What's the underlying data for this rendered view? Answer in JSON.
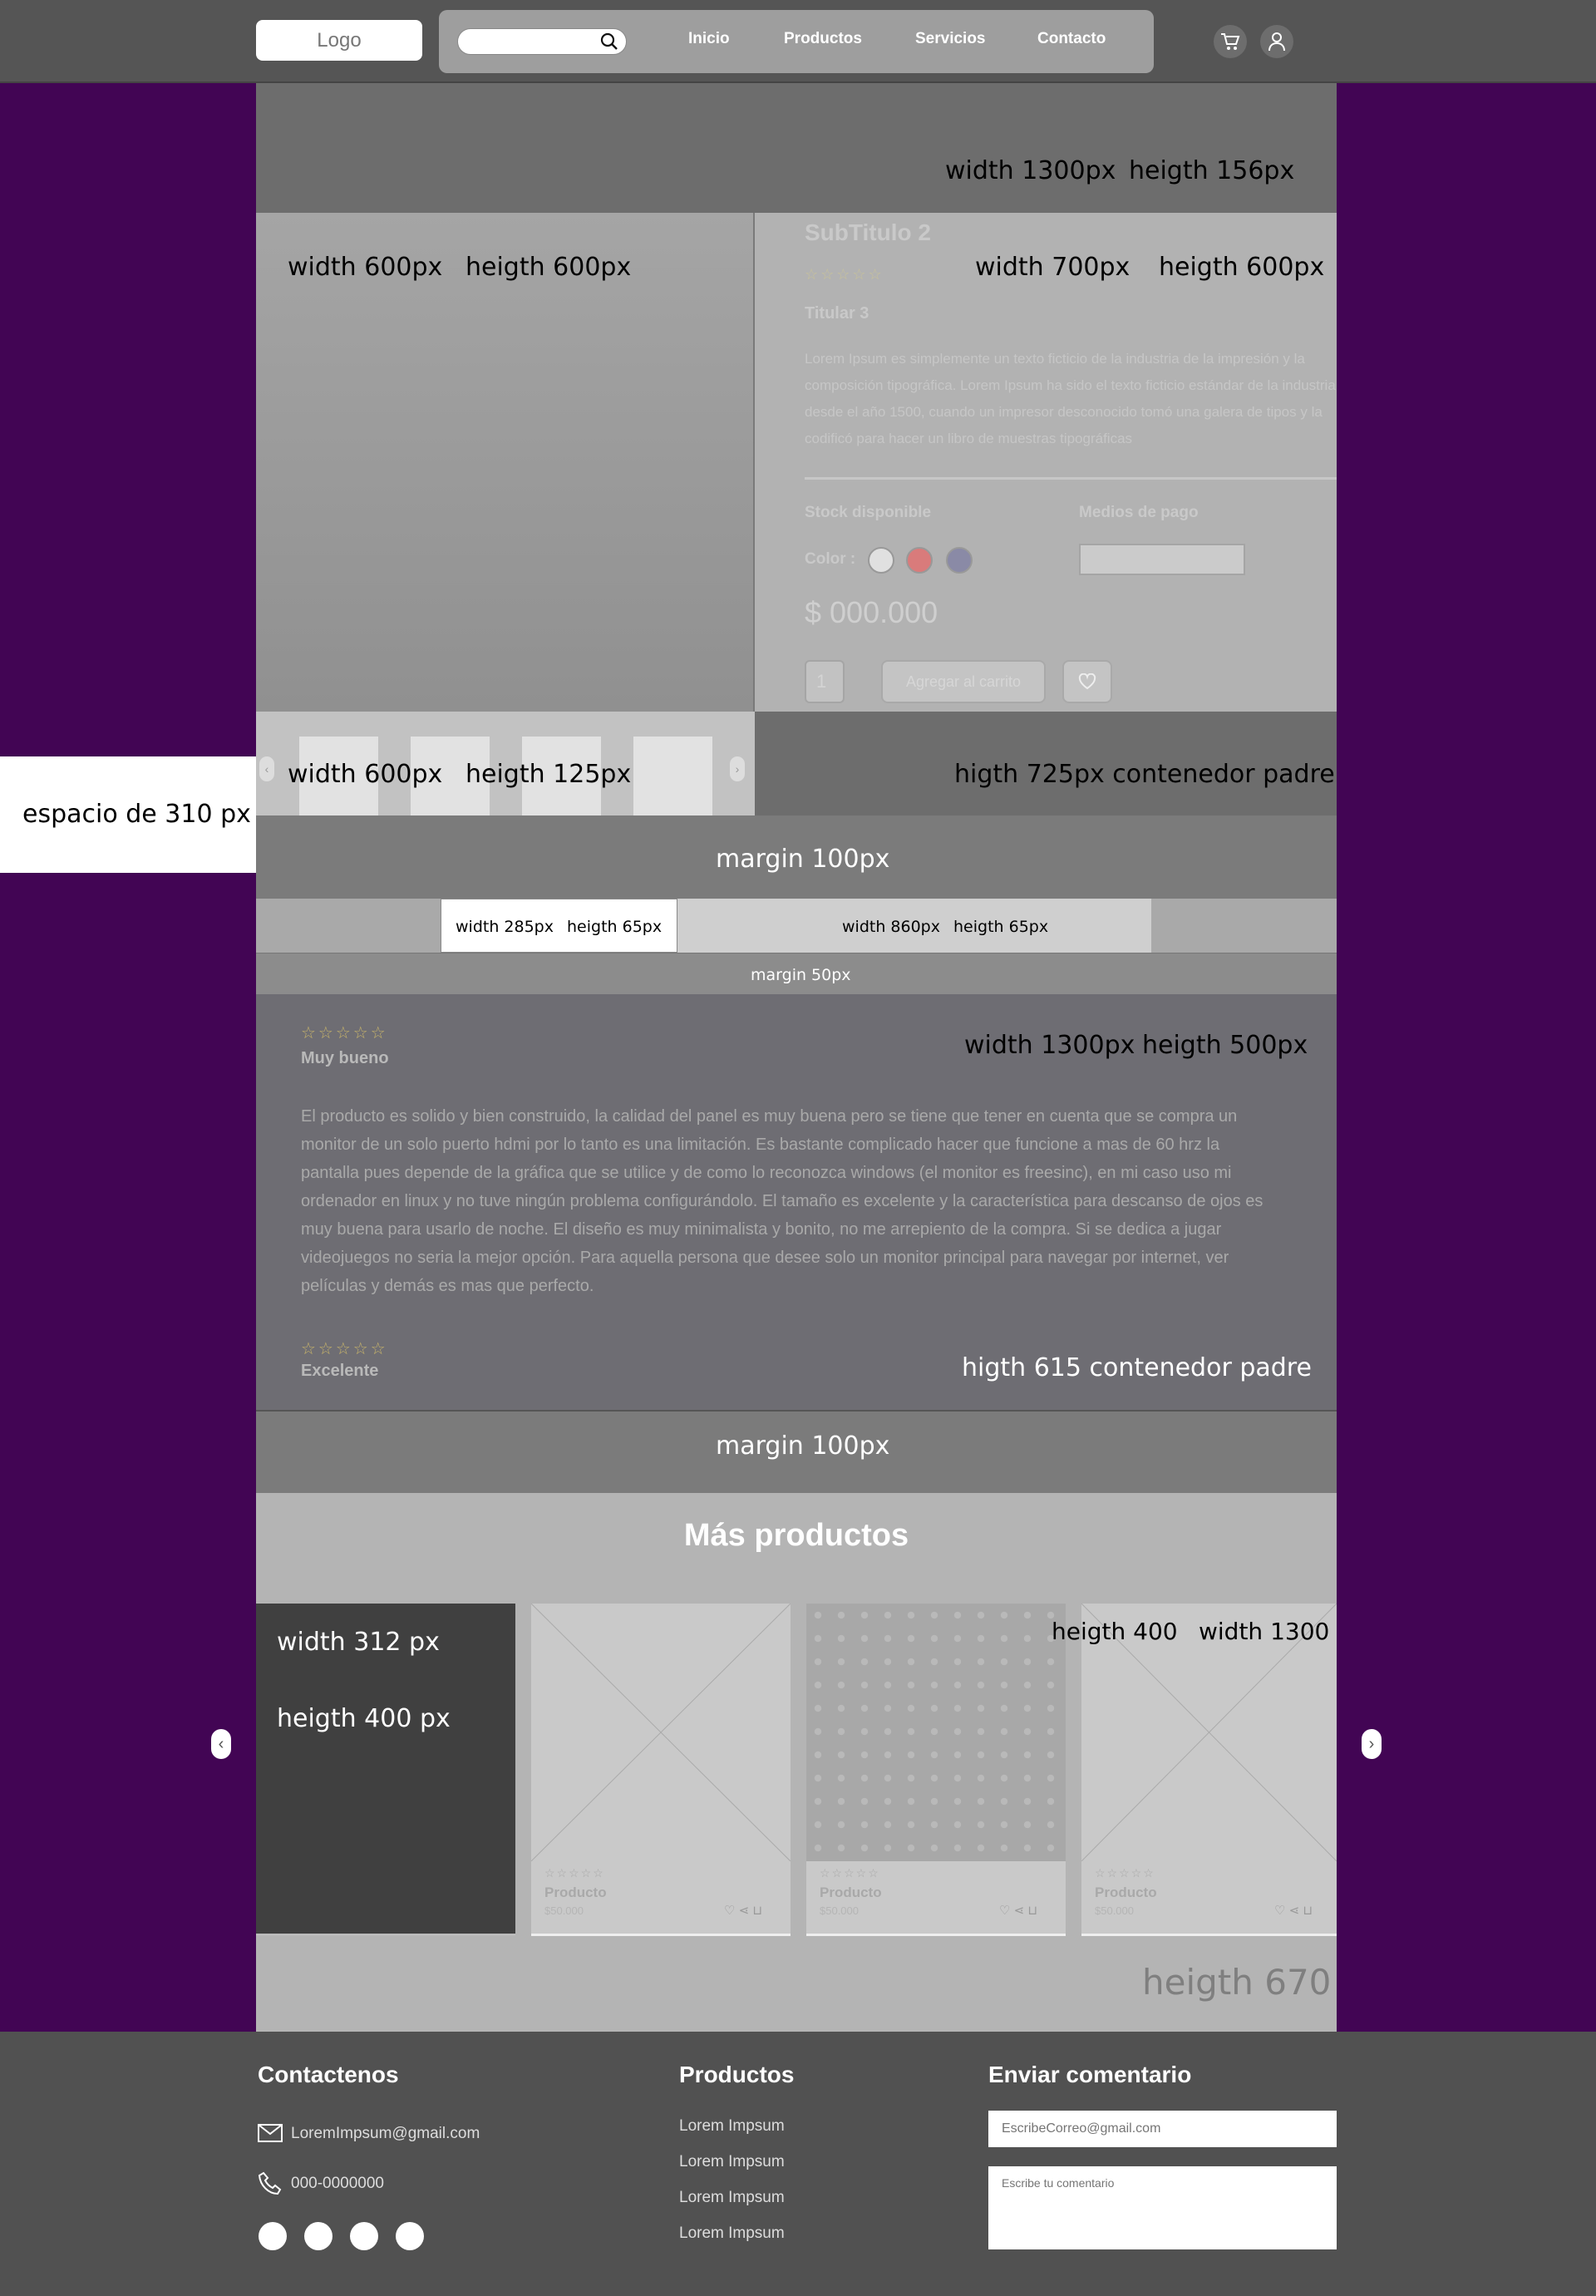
{
  "header": {
    "logo": "Logo",
    "nav": [
      "Inicio",
      "Productos",
      "Servicios",
      "Contacto"
    ]
  },
  "annotations": {
    "banner": [
      "width 1300px",
      "heigth 156px"
    ],
    "image": [
      "width 600px",
      "heigth 600px"
    ],
    "info": [
      "width 700px",
      "heigth 600px"
    ],
    "thumbs": [
      "width 600px",
      "heigth 125px"
    ],
    "parent1": "higth 725px contenedor padre",
    "side_space": "espacio de 310 px",
    "margin100": "margin 100px",
    "tab_a": [
      "width 285px",
      "heigth 65px"
    ],
    "tab_b": [
      "width 860px",
      "heigth 65px"
    ],
    "margin50": "margin 50px",
    "reviews": [
      "width 1300px",
      "heigth 500px"
    ],
    "parent2": "higth 615 contenedor padre",
    "more_size": [
      "heigth 400",
      "width 1300"
    ],
    "card_size": [
      "width 312 px",
      "heigth 400 px"
    ],
    "more_height": "heigth 670"
  },
  "product": {
    "subtitle": "SubTitulo 2",
    "titular": "Titular 3",
    "description": "Lorem Ipsum es simplemente un texto ficticio de la industria de la impresión y la composición tipográfica. Lorem Ipsum ha sido el texto ficticio estándar de la industria desde el año 1500, cuando un impresor desconocido tomó una galera de tipos y la codificó para hacer un libro de muestras tipográficas",
    "stock_label": "Stock disponible",
    "payment_label": "Medios de pago",
    "color_label": "Color :",
    "price": "$ 000.000",
    "qty": "1",
    "add_to_cart": "Agregar al carrito",
    "colors": [
      "#e0e0e0",
      "#d97b7b",
      "#8a8aa6"
    ]
  },
  "reviews": [
    {
      "rating_label": "Muy bueno",
      "text": "El producto es solido y bien construido, la calidad del panel es muy buena pero se tiene que tener en cuenta que se compra un monitor de un solo puerto hdmi por lo tanto es una limitación. Es bastante complicado hacer que funcione a mas de 60 hrz la pantalla pues depende de la gráfica que se utilice y de como lo reconozca windows (el monitor es freesinc), en mi caso uso mi ordenador en linux y no tuve ningún problema configurándolo. El tamaño es excelente y la característica para descanso de ojos es muy buena para usarlo de noche. El diseño es muy minimalista y bonito, no me arrepiento de la compra. Si se dedica a jugar videojuegos no seria la mejor opción. Para aquella persona que desee solo un monitor principal para navegar por internet, ver películas y demás es mas que perfecto."
    },
    {
      "rating_label": "Excelente"
    }
  ],
  "more_products": {
    "title": "Más productos",
    "cards": [
      {
        "name": "Producto",
        "price": "$50.000"
      },
      {
        "name": "Producto",
        "price": "$50.000"
      },
      {
        "name": "Producto",
        "price": "$50.000"
      }
    ]
  },
  "footer": {
    "contact_title": "Contactenos",
    "email": "LoremImpsum@gmail.com",
    "phone": "000-0000000",
    "products_title": "Productos",
    "product_links": [
      "Lorem Impsum",
      "Lorem Impsum",
      "Lorem Impsum",
      "Lorem Impsum"
    ],
    "comment_title": "Enviar comentario",
    "email_placeholder": "EscribeCorreo@gmail.com",
    "comment_placeholder": "Escribe tu comentario"
  },
  "icons": {
    "search": "search-icon",
    "cart": "cart-icon",
    "user": "user-icon",
    "heart": "heart-icon",
    "share": "share-icon",
    "mail": "mail-icon",
    "phone": "phone-icon",
    "chevron_left": "chevron-left-icon",
    "chevron_right": "chevron-right-icon",
    "star": "star-icon"
  },
  "colors": {
    "page_bg": "#420554",
    "header_bg": "#555555",
    "footer_bg": "#515151",
    "star": "#c8b46a"
  }
}
